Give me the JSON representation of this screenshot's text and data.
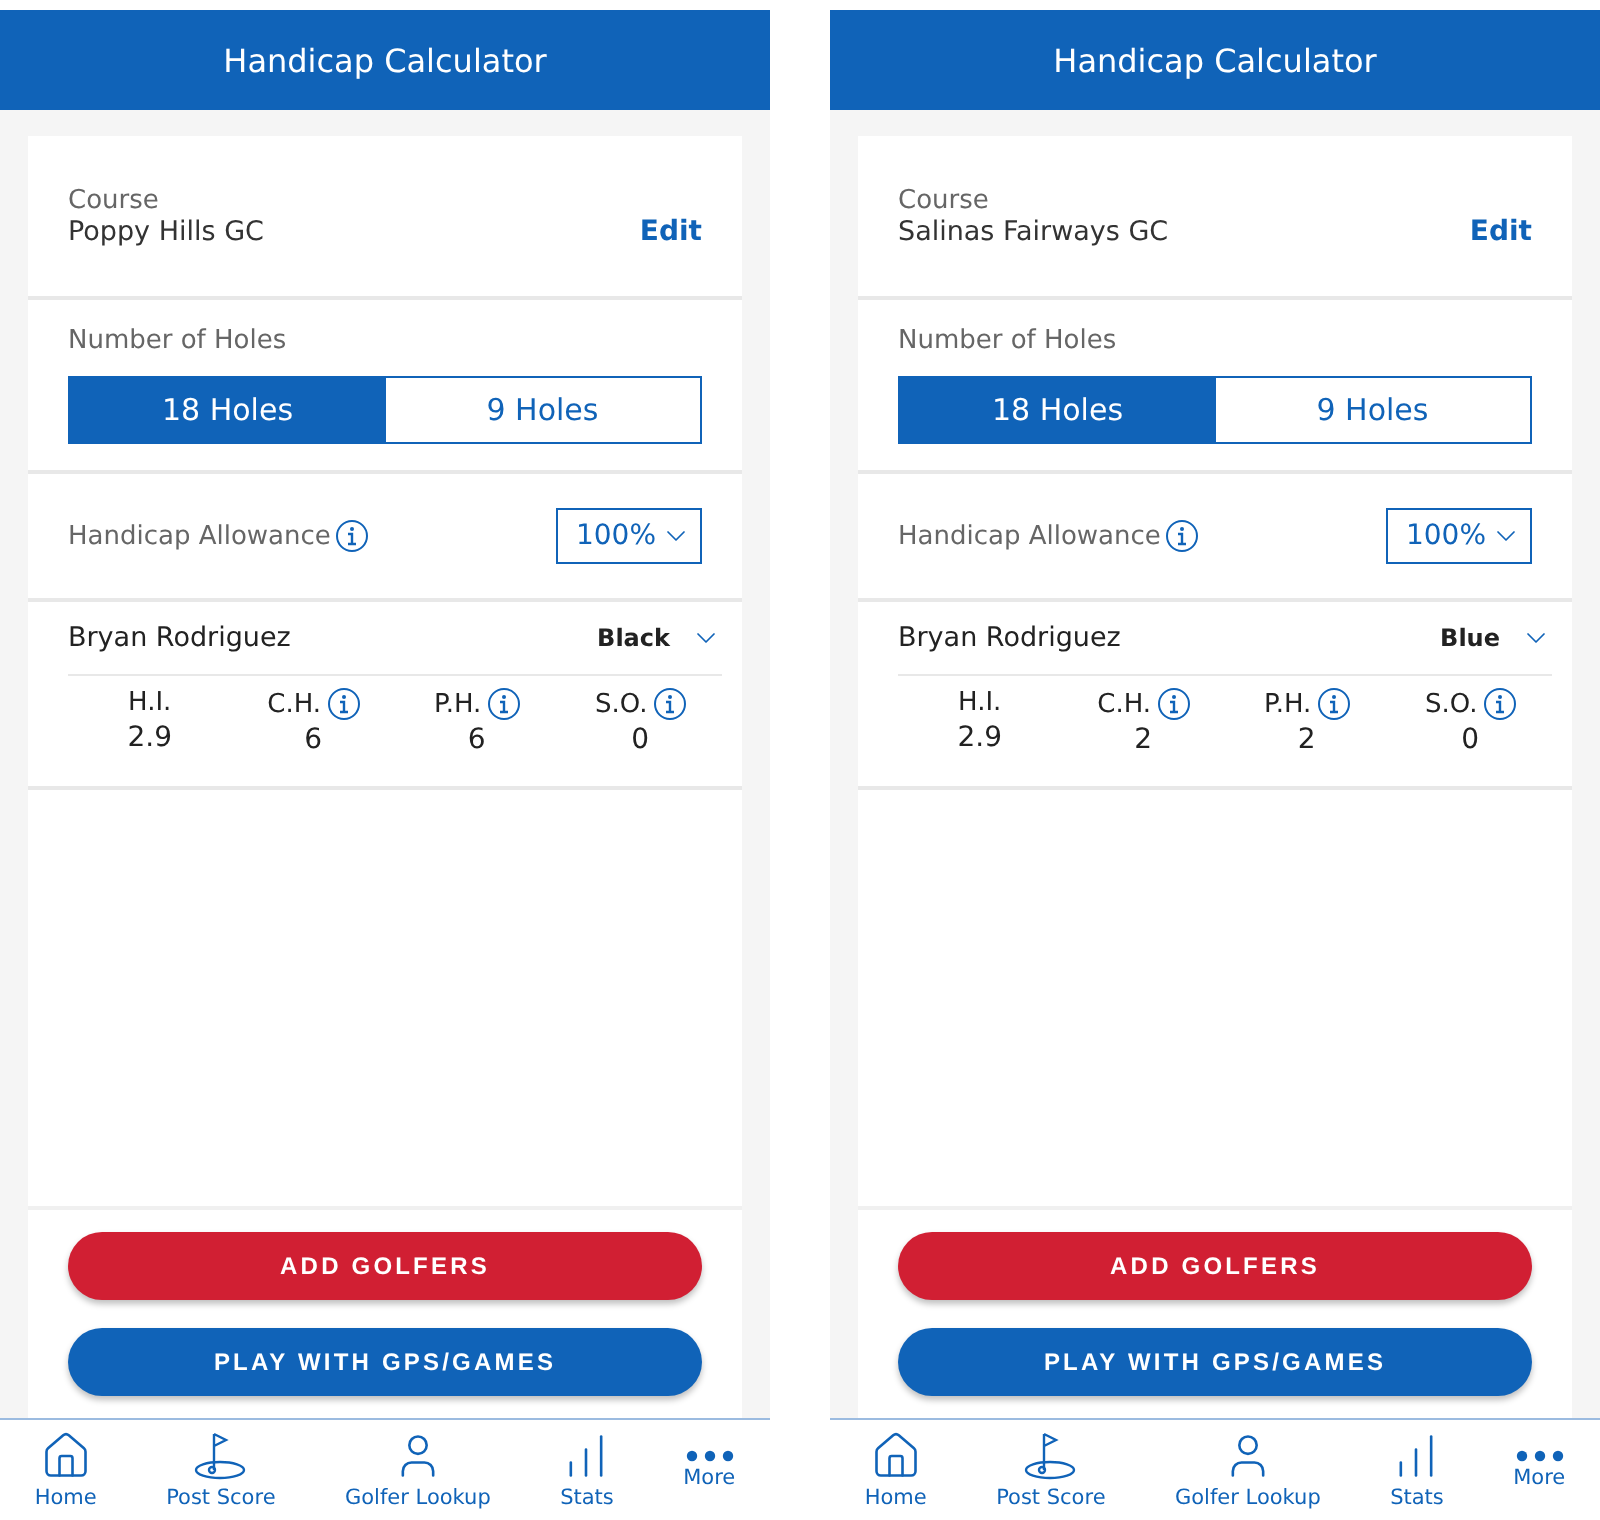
{
  "screens": [
    {
      "title": "Handicap Calculator",
      "course": {
        "label": "Course",
        "name": "Poppy Hills GC",
        "action": "Edit"
      },
      "holes": {
        "label": "Number of Holes",
        "options": [
          {
            "label": "18 Holes",
            "selected": true
          },
          {
            "label": "9 Holes",
            "selected": false
          }
        ]
      },
      "allowance": {
        "label": "Handicap Allowance",
        "value": "100%"
      },
      "golfer": {
        "name": "Bryan Rodriguez",
        "tee": "Black",
        "stats": [
          {
            "label": "H.I.",
            "value": "2.9",
            "info": false
          },
          {
            "label": "C.H.",
            "value": "6",
            "info": true
          },
          {
            "label": "P.H.",
            "value": "6",
            "info": true
          },
          {
            "label": "S.O.",
            "value": "0",
            "info": true
          }
        ]
      },
      "buttons": [
        {
          "label": "ADD GOLFERS",
          "kind": "danger"
        },
        {
          "label": "PLAY WITH GPS/GAMES",
          "kind": "primary"
        }
      ],
      "nav": [
        {
          "label": "Home",
          "kind": "home"
        },
        {
          "label": "Post Score",
          "kind": "flag"
        },
        {
          "label": "Golfer Lookup",
          "kind": "person"
        },
        {
          "label": "Stats",
          "kind": "stats"
        },
        {
          "label": "More",
          "kind": "more"
        }
      ]
    },
    {
      "title": "Handicap Calculator",
      "course": {
        "label": "Course",
        "name": "Salinas Fairways GC",
        "action": "Edit"
      },
      "holes": {
        "label": "Number of Holes",
        "options": [
          {
            "label": "18 Holes",
            "selected": true
          },
          {
            "label": "9 Holes",
            "selected": false
          }
        ]
      },
      "allowance": {
        "label": "Handicap Allowance",
        "value": "100%"
      },
      "golfer": {
        "name": "Bryan Rodriguez",
        "tee": "Blue",
        "stats": [
          {
            "label": "H.I.",
            "value": "2.9",
            "info": false
          },
          {
            "label": "C.H.",
            "value": "2",
            "info": true
          },
          {
            "label": "P.H.",
            "value": "2",
            "info": true
          },
          {
            "label": "S.O.",
            "value": "0",
            "info": true
          }
        ]
      },
      "buttons": [
        {
          "label": "ADD GOLFERS",
          "kind": "danger"
        },
        {
          "label": "PLAY WITH GPS/GAMES",
          "kind": "primary"
        }
      ],
      "nav": [
        {
          "label": "Home",
          "kind": "home"
        },
        {
          "label": "Post Score",
          "kind": "flag"
        },
        {
          "label": "Golfer Lookup",
          "kind": "person"
        },
        {
          "label": "Stats",
          "kind": "stats"
        },
        {
          "label": "More",
          "kind": "more"
        }
      ]
    }
  ]
}
